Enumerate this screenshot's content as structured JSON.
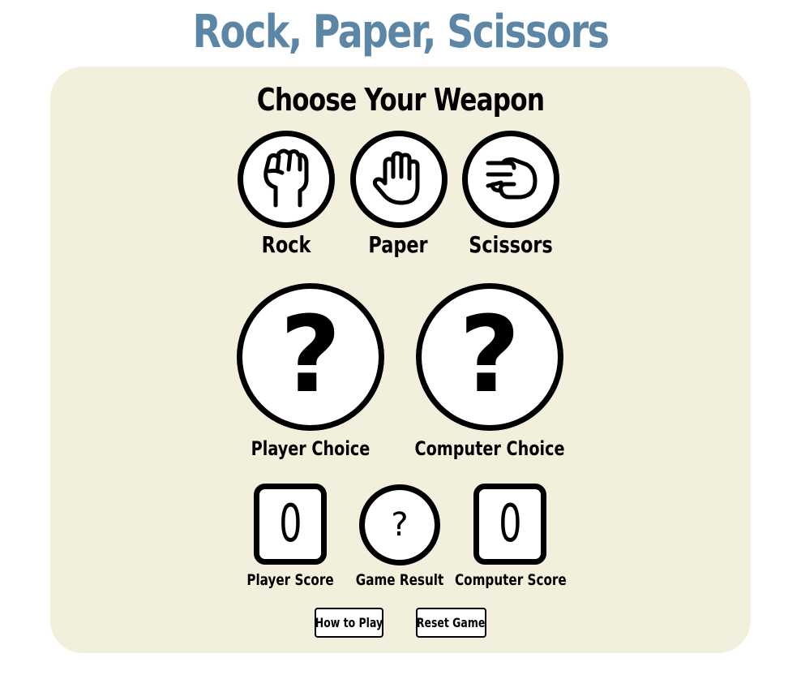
{
  "title": "Rock, Paper, Scissors",
  "colors": {
    "title": "#5b86a5",
    "panel": "#f2efdd"
  },
  "heading": "Choose Your Weapon",
  "weapons": [
    {
      "label": "Rock",
      "icon": "fist-icon"
    },
    {
      "label": "Paper",
      "icon": "open-hand-icon"
    },
    {
      "label": "Scissors",
      "icon": "scissors-hand-icon"
    }
  ],
  "choices": {
    "player": {
      "symbol": "?",
      "label": "Player Choice"
    },
    "computer": {
      "symbol": "?",
      "label": "Computer Choice"
    }
  },
  "scores": {
    "player": {
      "value": "0",
      "label": "Player Score"
    },
    "result": {
      "value": "?",
      "label": "Game Result"
    },
    "computer": {
      "value": "0",
      "label": "Computer Score"
    }
  },
  "buttons": {
    "how_to_play": "How to Play",
    "reset": "Reset Game"
  }
}
